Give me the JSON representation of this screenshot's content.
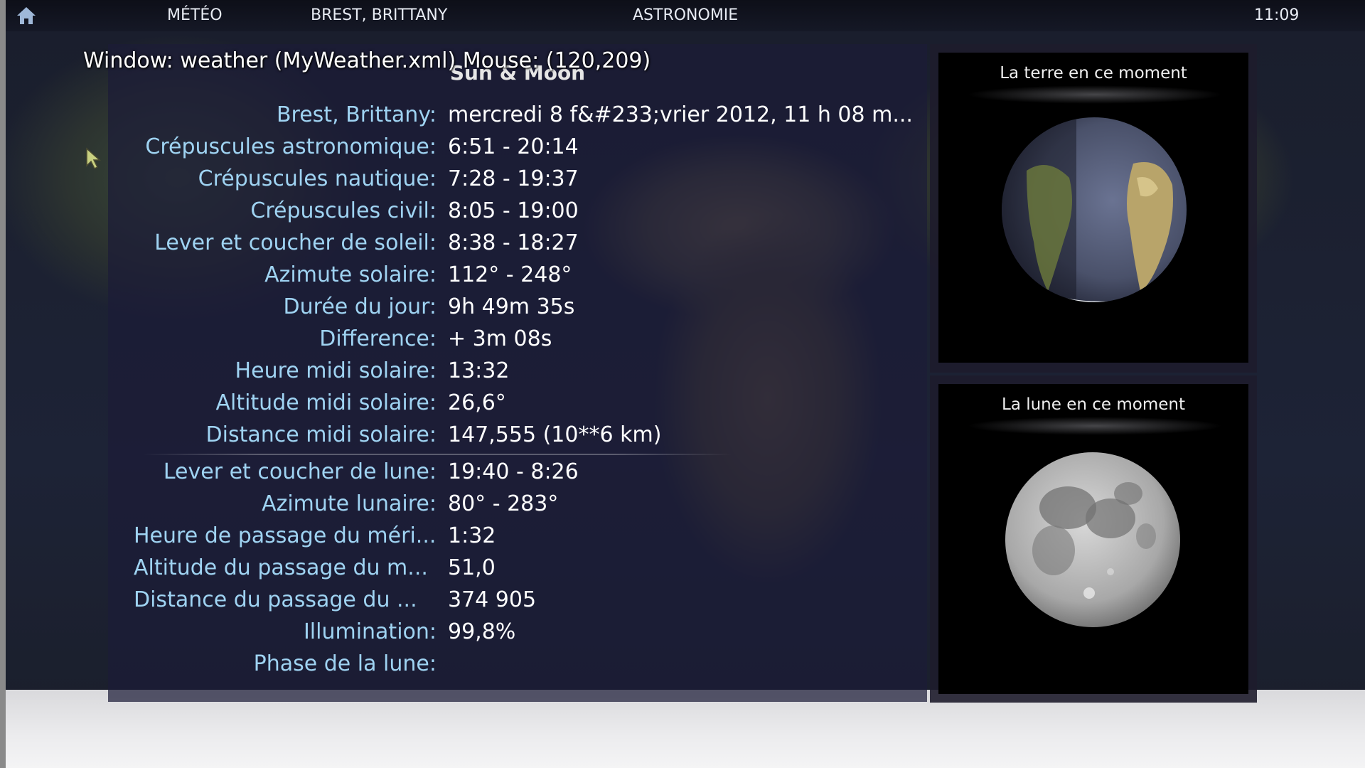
{
  "topbar": {
    "meteo": "MÉTÉO",
    "location": "BREST, BRITTANY",
    "astronomie": "ASTRONOMIE",
    "time": "11:09"
  },
  "overlay": {
    "window_info": "Window: weather (MyWeather.xml)  Mouse: (120,209)"
  },
  "panel": {
    "title": "Sun & Moon",
    "sun_rows": [
      {
        "label": "Brest, Brittany:",
        "value": "mercredi 8 f&#233;vrier 2012, 11 h 08 m..."
      },
      {
        "label": "Crépuscules astronomique:",
        "value": "6:51 - 20:14"
      },
      {
        "label": "Crépuscules nautique:",
        "value": "7:28 - 19:37"
      },
      {
        "label": "Crépuscules civil:",
        "value": "8:05 - 19:00"
      },
      {
        "label": "Lever et coucher de soleil:",
        "value": "8:38 - 18:27"
      },
      {
        "label": "Azimute solaire:",
        "value": "112° - 248°"
      },
      {
        "label": "Durée du jour:",
        "value": "9h 49m 35s"
      },
      {
        "label": "Difference:",
        "value": "+ 3m 08s"
      },
      {
        "label": "Heure midi solaire:",
        "value": "13:32"
      },
      {
        "label": "Altitude midi solaire:",
        "value": "26,6°"
      },
      {
        "label": "Distance midi solaire:",
        "value": "147,555 (10**6 km)"
      }
    ],
    "moon_rows": [
      {
        "label": "Lever et coucher de lune:",
        "value": "19:40 - 8:26"
      },
      {
        "label": "Azimute lunaire:",
        "value": "80° - 283°"
      },
      {
        "label": "Heure de passage du méri...",
        "value": "1:32"
      },
      {
        "label": "Altitude du passage du m...",
        "value": "51,0"
      },
      {
        "label": "Distance du passage du ...",
        "value": "374 905"
      },
      {
        "label": "Illumination:",
        "value": "99,8%"
      },
      {
        "label": "Phase de la lune:",
        "value": ""
      }
    ]
  },
  "earth_panel": {
    "title": "La terre en ce moment"
  },
  "moon_panel": {
    "title": "La lune en ce moment"
  },
  "icons": {
    "home": "home-icon",
    "cursor": "mouse-cursor-icon"
  },
  "colors": {
    "label": "#9fd3f2",
    "value": "#ffffff",
    "panel_bg": "#1c1c38"
  }
}
